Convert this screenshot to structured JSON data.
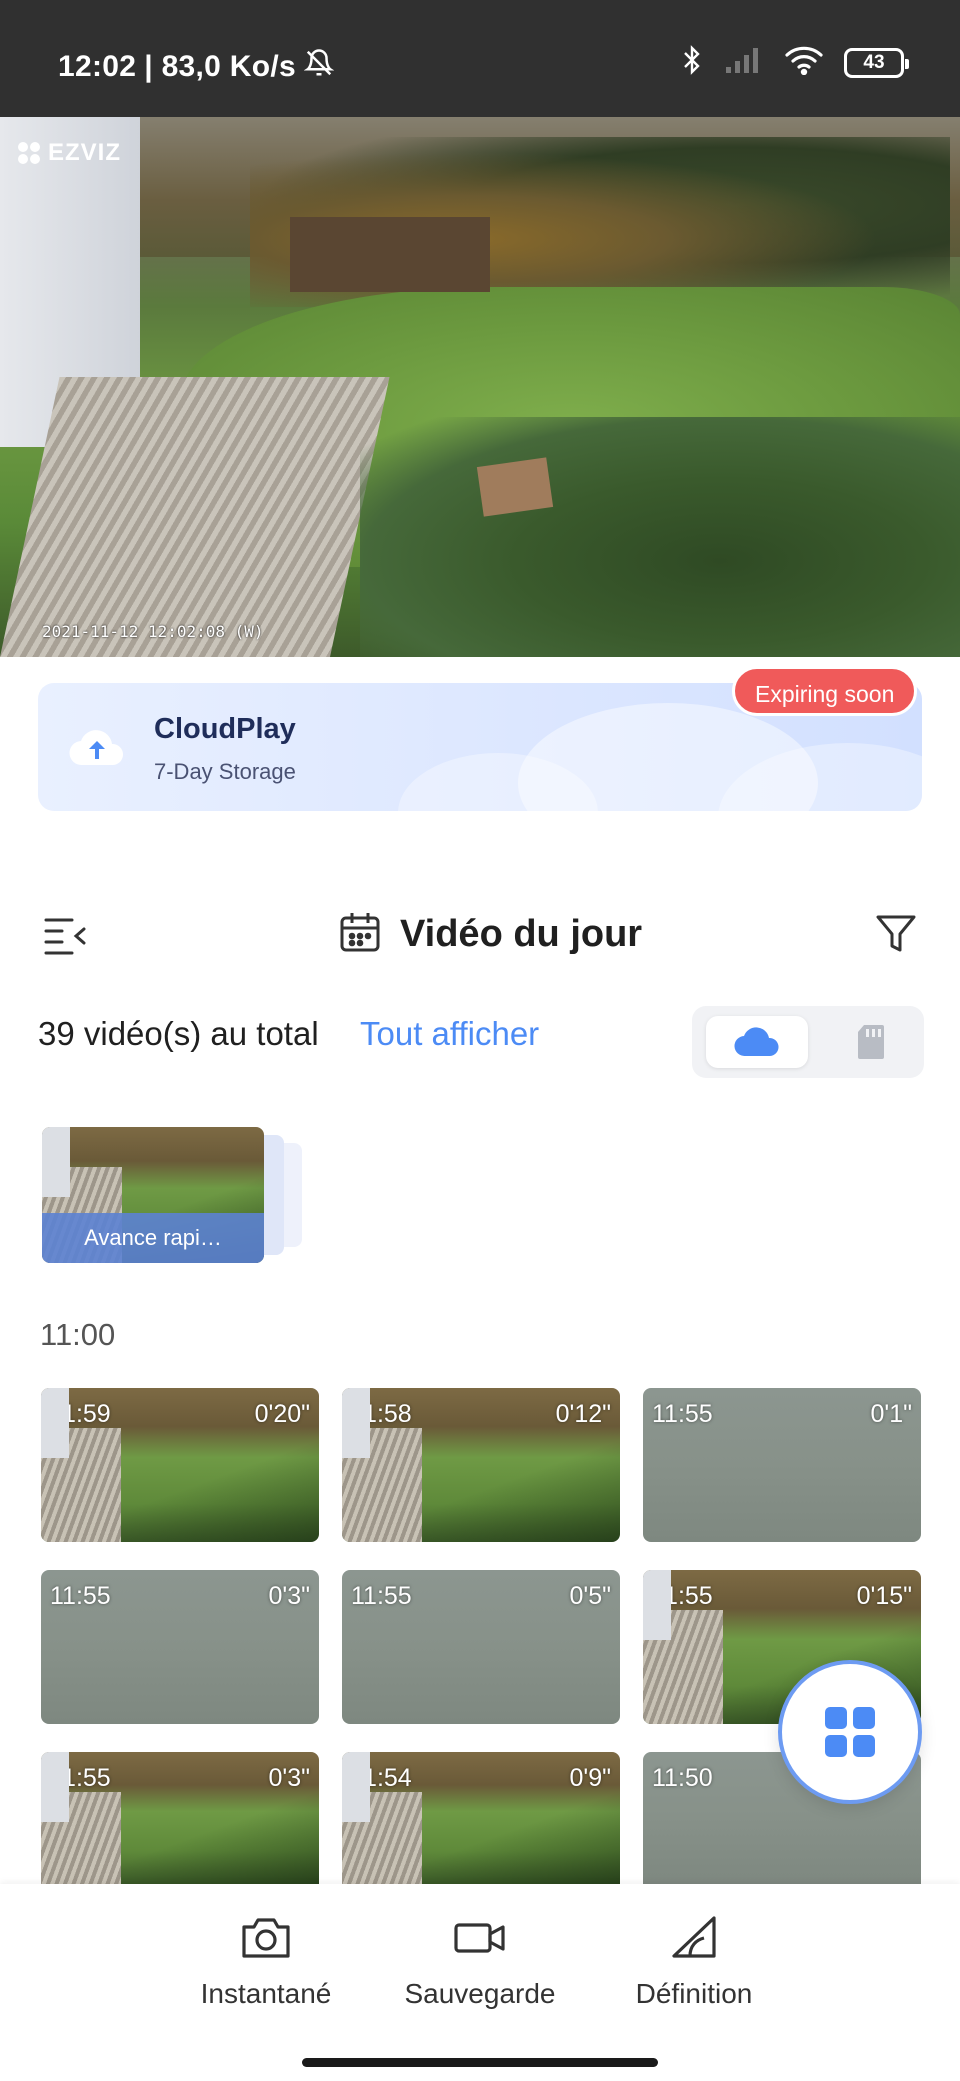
{
  "status_bar": {
    "time": "12:02",
    "speed": "| 83,0 Ko/s",
    "battery": "43"
  },
  "camera": {
    "brand": "EZVIZ",
    "timestamp": "2021-11-12 12:02:08 (W)"
  },
  "cloud_card": {
    "title": "CloudPlay",
    "subtitle": "7-Day Storage",
    "badge": "Expiring soon",
    "accent": "#4c8bf5",
    "badge_color": "#f05a5a"
  },
  "header": {
    "title": "Vidéo du jour"
  },
  "totals": {
    "count_text": "39 vidéo(s) au total",
    "show_all": "Tout afficher"
  },
  "fast_forward": {
    "label": "Avance rapi…"
  },
  "section": {
    "time": "11:00"
  },
  "clips": [
    {
      "time": "11:59",
      "duration": "0'20\"",
      "thumb": "scene"
    },
    {
      "time": "11:58",
      "duration": "0'12\"",
      "thumb": "scene"
    },
    {
      "time": "11:55",
      "duration": "0'1\"",
      "thumb": "blur"
    },
    {
      "time": "11:55",
      "duration": "0'3\"",
      "thumb": "blur"
    },
    {
      "time": "11:55",
      "duration": "0'5\"",
      "thumb": "blur"
    },
    {
      "time": "11:55",
      "duration": "0'15\"",
      "thumb": "scene"
    },
    {
      "time": "11:55",
      "duration": "0'3\"",
      "thumb": "scene"
    },
    {
      "time": "11:54",
      "duration": "0'9\"",
      "thumb": "scene"
    },
    {
      "time": "11:50",
      "duration": "",
      "thumb": "blur"
    }
  ],
  "toolbar": {
    "snapshot": "Instantané",
    "record": "Sauvegarde",
    "definition": "Définition"
  }
}
